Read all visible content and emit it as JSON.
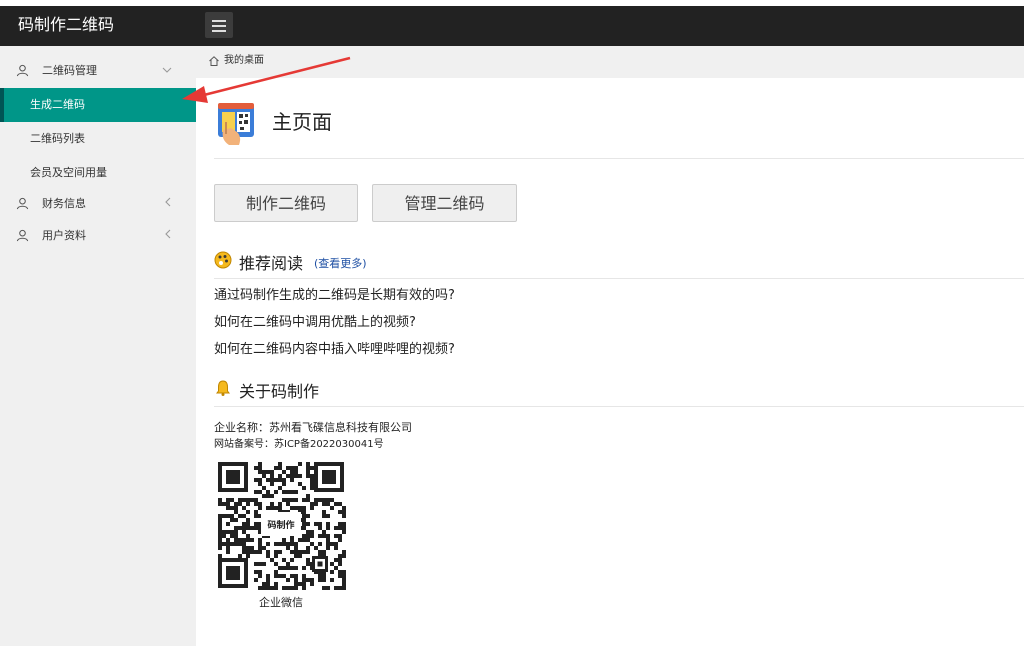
{
  "app": {
    "brand": "码制作二维码"
  },
  "sidebar": {
    "groups": [
      {
        "label": "二维码管理",
        "icon": "user-icon",
        "children": [
          {
            "label": "生成二维码",
            "active": true
          },
          {
            "label": "二维码列表"
          },
          {
            "label": "会员及空间用量"
          }
        ]
      },
      {
        "label": "财务信息",
        "icon": "user-icon"
      },
      {
        "label": "用户资料",
        "icon": "user-icon"
      }
    ]
  },
  "breadcrumb": {
    "label": "我的桌面",
    "icon": "home-icon"
  },
  "page": {
    "title": "主页面"
  },
  "actions": {
    "make_label": "制作二维码",
    "manage_label": "管理二维码"
  },
  "reading": {
    "title": "推荐阅读",
    "more": "(查看更多)",
    "articles": [
      "通过码制作生成的二维码是长期有效的吗?",
      "如何在二维码中调用优酷上的视频?",
      "如何在二维码内容中插入哔哩哔哩的视频?"
    ]
  },
  "about": {
    "title": "关于码制作",
    "company": "企业名称：苏州看飞碟信息科技有限公司",
    "icp": "网站备案号：苏ICP备2022030041号",
    "qr_center": "码制作",
    "qr_caption": "企业微信"
  },
  "colors": {
    "topbar": "#222222",
    "active_nav": "#009688",
    "link": "#1e4fa3",
    "annotation_arrow": "#e53935"
  }
}
